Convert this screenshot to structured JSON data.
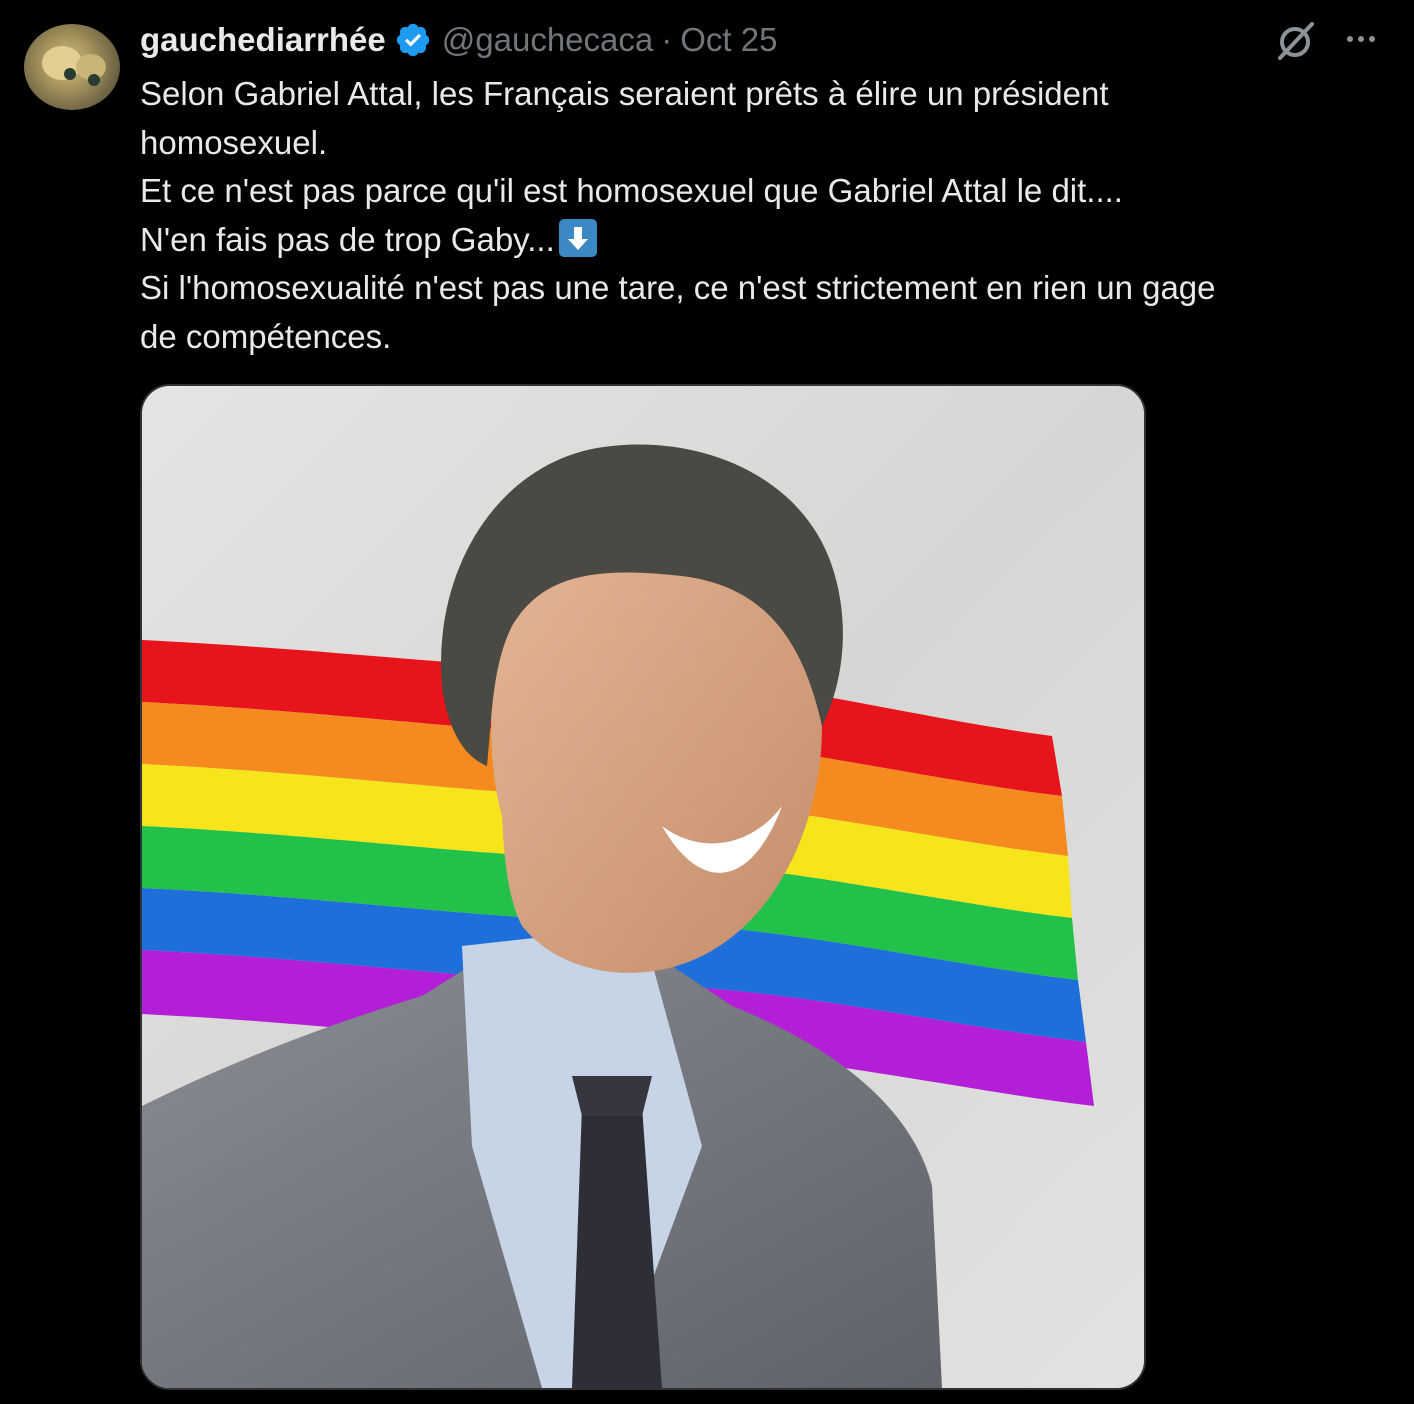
{
  "tweet": {
    "author": {
      "display_name": "gauchediarrhée",
      "handle": "@gauchecaca",
      "verified": true
    },
    "separator": "·",
    "date": "Oct 25",
    "text_lines": [
      "Selon Gabriel Attal, les Français seraient prêts à élire un président",
      "homosexuel.",
      "Et ce n'est pas parce qu'il est homosexuel que Gabriel Attal le dit....",
      "N'en fais pas de trop Gaby...",
      "Si l'homosexualité n'est pas une tare, ce n'est strictement en rien un gage",
      "de compétences."
    ],
    "emoji": "down-arrow-emoji",
    "media": {
      "description_icon": "photo",
      "flag_colors": [
        "#e8141c",
        "#f58a1f",
        "#f6e51b",
        "#22c24a",
        "#1f6fdb",
        "#b21fd6"
      ]
    }
  },
  "icons": {
    "verified": "verified-badge-icon",
    "grok": "grok-icon",
    "more": "more-options-icon"
  },
  "colors": {
    "background": "#000000",
    "text": "#e7e9ea",
    "muted": "#71767b",
    "verified_blue": "#1d9bf0"
  }
}
